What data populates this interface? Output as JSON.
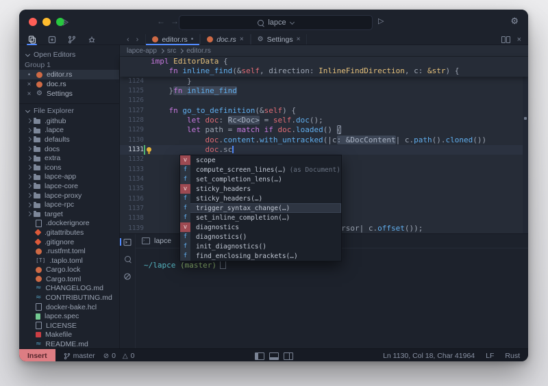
{
  "glyphs": {
    "close": "×",
    "dot": "•",
    "back": "←",
    "forward": "→",
    "prev": "‹",
    "next": "›",
    "run": "▷",
    "gear": "⚙",
    "error": "⊘",
    "warning": "△",
    "breadcrumb_sep": ">",
    "md": "≈",
    "taplo": "[T]"
  },
  "titlebar": {
    "search_value": "lapce"
  },
  "tab_bar": {
    "items": [
      {
        "label": "editor.rs",
        "icon": "rust",
        "modified": true,
        "active": true
      },
      {
        "label": "doc.rs",
        "icon": "rust",
        "preview": true,
        "closable": true
      },
      {
        "label": "Settings",
        "icon": "gear",
        "closable": true
      }
    ]
  },
  "breadcrumb": {
    "parts": [
      "lapce-app",
      "src",
      "editor.rs"
    ]
  },
  "sidebar": {
    "open_editors": {
      "title": "Open Editors",
      "group": "Group 1",
      "items": [
        {
          "label": "editor.rs",
          "icon": "rust",
          "marker": "dot",
          "active": true
        },
        {
          "label": "doc.rs",
          "icon": "rust",
          "marker": "close",
          "active": false
        },
        {
          "label": "Settings",
          "icon": "gear",
          "marker": "close",
          "active": false
        }
      ]
    },
    "file_explorer": {
      "title": "File Explorer",
      "items": [
        {
          "label": ".github",
          "type": "folder"
        },
        {
          "label": ".lapce",
          "type": "folder"
        },
        {
          "label": "defaults",
          "type": "folder"
        },
        {
          "label": "docs",
          "type": "folder"
        },
        {
          "label": "extra",
          "type": "folder"
        },
        {
          "label": "icons",
          "type": "folder"
        },
        {
          "label": "lapce-app",
          "type": "folder"
        },
        {
          "label": "lapce-core",
          "type": "folder"
        },
        {
          "label": "lapce-proxy",
          "type": "folder"
        },
        {
          "label": "lapce-rpc",
          "type": "folder"
        },
        {
          "label": "target",
          "type": "folder"
        },
        {
          "label": ".dockerignore",
          "type": "file"
        },
        {
          "label": ".gitattributes",
          "type": "git"
        },
        {
          "label": ".gitignore",
          "type": "git"
        },
        {
          "label": ".rustfmt.toml",
          "type": "rust"
        },
        {
          "label": ".taplo.toml",
          "type": "taplo"
        },
        {
          "label": "Cargo.lock",
          "type": "rust"
        },
        {
          "label": "Cargo.toml",
          "type": "rust"
        },
        {
          "label": "CHANGELOG.md",
          "type": "md"
        },
        {
          "label": "CONTRIBUTING.md",
          "type": "md"
        },
        {
          "label": "docker-bake.hcl",
          "type": "file"
        },
        {
          "label": "lapce.spec",
          "type": "spec"
        },
        {
          "label": "LICENSE",
          "type": "file"
        },
        {
          "label": "Makefile",
          "type": "make"
        },
        {
          "label": "README.md",
          "type": "md"
        }
      ]
    }
  },
  "editor": {
    "sticky_lines": [
      {
        "segs": [
          [
            "impl ",
            "k"
          ],
          [
            "EditorData ",
            "t"
          ],
          [
            "{",
            "p"
          ]
        ]
      },
      {
        "segs": [
          [
            "    ",
            "p"
          ],
          [
            "fn ",
            "k"
          ],
          [
            "inline_find",
            "f"
          ],
          [
            "(&",
            "p"
          ],
          [
            "self",
            "v"
          ],
          [
            ", direction: ",
            "p"
          ],
          [
            "InlineFindDirection",
            "t"
          ],
          [
            ", c: ",
            "p"
          ],
          [
            "&str",
            "t"
          ],
          [
            ") {",
            "p"
          ]
        ]
      }
    ],
    "lines": [
      {
        "num": "1124",
        "segs": [
          [
            "        }",
            "p"
          ]
        ]
      },
      {
        "num": "1125",
        "segs": [
          [
            "    }",
            "p"
          ],
          [
            "fn ",
            "bx k"
          ],
          [
            "inline_find",
            "bx f"
          ]
        ]
      },
      {
        "num": "1126",
        "segs": []
      },
      {
        "num": "1127",
        "segs": [
          [
            "    ",
            "p"
          ],
          [
            "fn ",
            "k"
          ],
          [
            "go_to_definition",
            "f"
          ],
          [
            "(&",
            "p"
          ],
          [
            "self",
            "v"
          ],
          [
            ") {",
            "p"
          ]
        ]
      },
      {
        "num": "1128",
        "segs": [
          [
            "        ",
            "p"
          ],
          [
            "let ",
            "k"
          ],
          [
            "doc",
            "v"
          ],
          [
            ": ",
            "p"
          ],
          [
            "Rc<Doc>",
            "bx"
          ],
          [
            " = ",
            "p"
          ],
          [
            "self",
            "v"
          ],
          [
            ".",
            "p"
          ],
          [
            "doc",
            "f"
          ],
          [
            "();",
            "p"
          ]
        ]
      },
      {
        "num": "1129",
        "segs": [
          [
            "        ",
            "p"
          ],
          [
            "let ",
            "k"
          ],
          [
            "path = ",
            "p"
          ],
          [
            "match ",
            "k"
          ],
          [
            "if ",
            "k"
          ],
          [
            "doc",
            "v"
          ],
          [
            ".",
            "p"
          ],
          [
            "loaded",
            "f"
          ],
          [
            "() ",
            "p"
          ],
          [
            "{",
            "p brk"
          ]
        ]
      },
      {
        "num": "1130",
        "segs": [
          [
            "            ",
            "p"
          ],
          [
            "doc",
            "v"
          ],
          [
            ".",
            "p"
          ],
          [
            "content",
            "f"
          ],
          [
            ".",
            "p"
          ],
          [
            "with_untracked",
            "f"
          ],
          [
            "(|c",
            "p"
          ],
          [
            ": &DocContent",
            "bx"
          ],
          [
            "| c",
            "p"
          ],
          [
            ".",
            "p"
          ],
          [
            "path",
            "f"
          ],
          [
            "().",
            "p"
          ],
          [
            "cloned",
            "f"
          ],
          [
            "())",
            "p"
          ]
        ]
      },
      {
        "num": "1131",
        "segs": [
          [
            "            ",
            "p"
          ],
          [
            "doc",
            "v"
          ],
          [
            ".sc",
            "p"
          ]
        ],
        "current": true,
        "bulb": true,
        "changed": true,
        "caret": true
      },
      {
        "num": "1132",
        "segs": [
          [
            "        ",
            "p"
          ],
          [
            "}",
            "p brk"
          ],
          [
            " el",
            "p"
          ]
        ]
      },
      {
        "num": "1133",
        "segs": []
      },
      {
        "num": "1134",
        "segs": [
          [
            "        } {",
            "p"
          ]
        ]
      },
      {
        "num": "1135",
        "segs": []
      },
      {
        "num": "1136",
        "segs": []
      },
      {
        "num": "1137",
        "segs": [
          [
            "        };",
            "p"
          ]
        ]
      },
      {
        "num": "1138",
        "segs": []
      },
      {
        "num": "1139",
        "segs": [
          [
            "        ",
            "p"
          ],
          [
            "let",
            "k"
          ],
          [
            "                               ",
            "p"
          ],
          [
            "rsor| c",
            "p"
          ],
          [
            ".",
            "p"
          ],
          [
            "offset",
            "f"
          ],
          [
            "());",
            "p"
          ]
        ]
      }
    ]
  },
  "completion": {
    "items": [
      {
        "kind": "v",
        "label": "scope"
      },
      {
        "kind": "f",
        "label": "compute_screen_lines(…)",
        "note": "(as Document)"
      },
      {
        "kind": "f",
        "label": "set_completion_lens(…)"
      },
      {
        "kind": "v",
        "label": "sticky_headers"
      },
      {
        "kind": "f",
        "label": "sticky_headers(…)"
      },
      {
        "kind": "f",
        "label": "trigger_syntax_change(…)",
        "selected": true
      },
      {
        "kind": "f",
        "label": "set_inline_completion(…)"
      },
      {
        "kind": "v",
        "label": "diagnostics"
      },
      {
        "kind": "f",
        "label": "diagnostics()"
      },
      {
        "kind": "f",
        "label": "init_diagnostics()"
      },
      {
        "kind": "f",
        "label": "find_enclosing_brackets(…)"
      }
    ]
  },
  "terminal": {
    "tab_label": "lapce",
    "prompt_path": "~/lapce",
    "prompt_branch": "(master)"
  },
  "status_bar": {
    "mode": "Insert",
    "branch": "master",
    "errors": "0",
    "warnings": "0",
    "position": "Ln 1130, Col 18, Char 41964",
    "line_ending": "LF",
    "language": "Rust"
  }
}
